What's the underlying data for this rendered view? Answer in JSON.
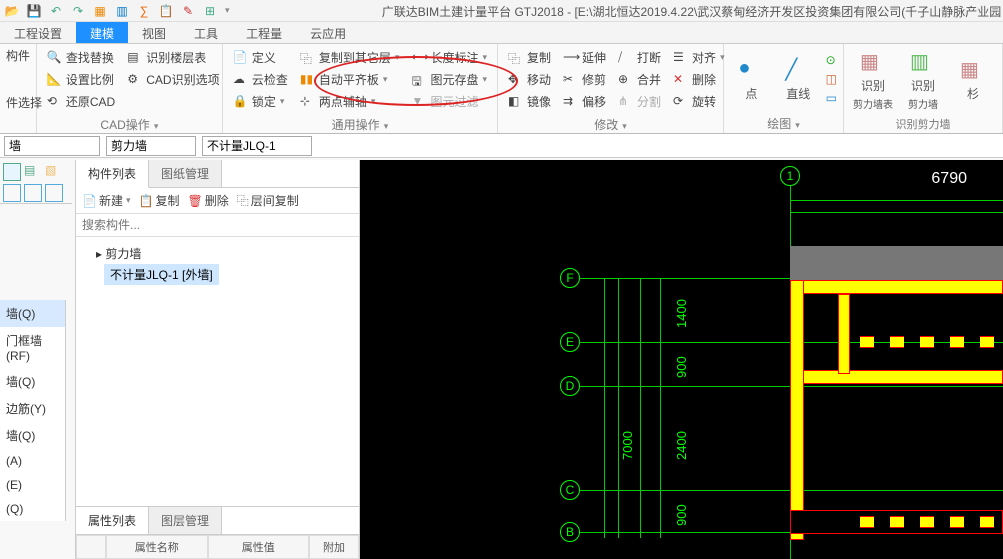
{
  "app_title": "广联达BIM土建计量平台 GTJ2018 - [E:\\湖北恒达2019.4.22\\武汉蔡甸经济开发区投资集团有限公司(千子山静脉产业园",
  "menu": {
    "items": [
      "工程设置",
      "建模",
      "视图",
      "工具",
      "工程量",
      "云应用"
    ],
    "active": 1
  },
  "side_top": {
    "a": "构件",
    "b": "件选择"
  },
  "ribbon": {
    "group1": {
      "items": [
        "查找替换",
        "设置比例",
        "还原CAD",
        "识别楼层表",
        "CAD识别选项"
      ],
      "label": "CAD操作"
    },
    "group2": {
      "col1": [
        "定义",
        "云检查",
        "锁定"
      ],
      "col2": [
        "复制到其它层",
        "自动平齐板",
        "两点辅轴"
      ],
      "col3": [
        "长度标注",
        "图元存盘",
        "图元过滤"
      ],
      "label": "通用操作"
    },
    "group3": {
      "col1": [
        "复制",
        "移动",
        "镜像"
      ],
      "col2": [
        "延伸",
        "修剪",
        "偏移"
      ],
      "col3": [
        "打断",
        "合并",
        "分割"
      ],
      "col4": [
        "对齐",
        "删除",
        "旋转"
      ],
      "label": "修改"
    },
    "group4": {
      "point": "点",
      "line": "直线",
      "label": "绘图"
    },
    "group5": {
      "a": "识别",
      "a2": "剪力墙表",
      "b": "识别",
      "b2": "剪力墙",
      "c": "杉",
      "label": "识别剪力墙"
    }
  },
  "selectors": {
    "s1": "墙",
    "s2": "剪力墙",
    "s3": "不计量JLQ-1"
  },
  "left_stub": [
    "墙(Q)",
    "门框墙(RF)",
    "墙(Q)",
    "边筋(Y)",
    "墙(Q)",
    "(A)",
    "(E)",
    "(Q)"
  ],
  "panel": {
    "tabs": [
      "构件列表",
      "图纸管理"
    ],
    "toolbar": {
      "new": "新建",
      "copy": "复制",
      "del": "删除",
      "layercopy": "层间复制"
    },
    "search_ph": "搜索构件...",
    "tree_root": "剪力墙",
    "tree_leaf": "不计量JLQ-1 [外墙]"
  },
  "prop": {
    "tabs": [
      "属性列表",
      "图层管理"
    ],
    "headers": [
      "",
      "属性名称",
      "属性值",
      "附加"
    ]
  },
  "canvas": {
    "top_grid": "1",
    "top_dim": "6790",
    "rows": [
      "F",
      "E",
      "D",
      "C",
      "B"
    ],
    "v_dims": [
      "1400",
      "900",
      "2400",
      "900"
    ],
    "big_dim": "7000"
  }
}
